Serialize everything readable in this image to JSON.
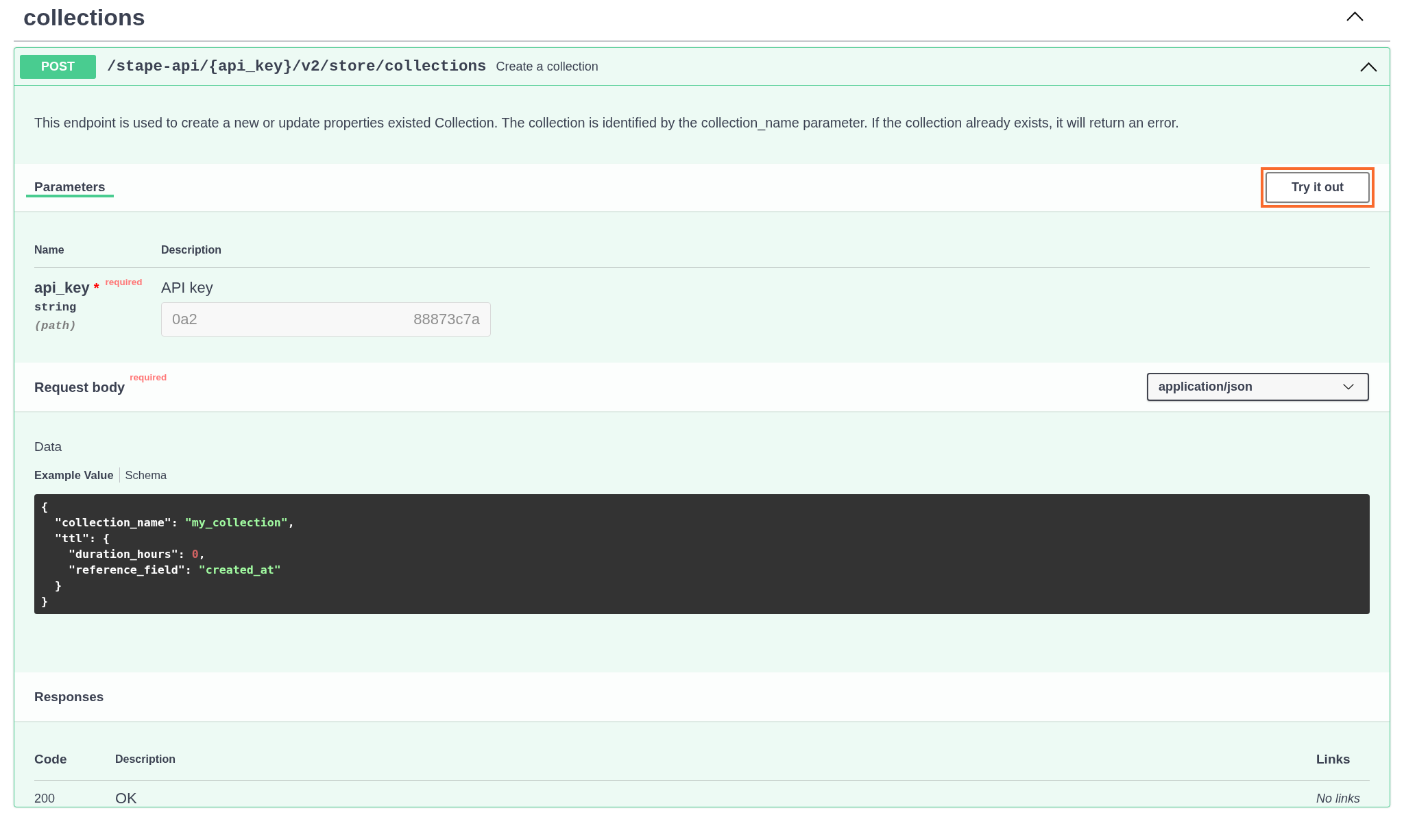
{
  "section": {
    "title": "collections",
    "expanded": true
  },
  "operation": {
    "method": "POST",
    "path": "/stape-api/{api_key}/v2/store/collections",
    "summary": "Create a collection",
    "expanded": true,
    "description": "This endpoint is used to create a new or update properties existed Collection. The collection is identified by the collection_name parameter. If the collection already exists, it will return an error.",
    "tabs": [
      {
        "label": "Parameters",
        "selected": true
      }
    ],
    "try_it_out": {
      "label": "Try it out",
      "highlighted": true
    },
    "parameters": {
      "columns": [
        "Name",
        "Description"
      ],
      "rows": [
        {
          "name": "api_key",
          "required": true,
          "required_mark": "*",
          "required_label": "required",
          "type": "string",
          "location": "(path)",
          "description": "API key",
          "field": {
            "value_start": "0a2",
            "value_end": "88873c7a",
            "disabled": true
          }
        }
      ]
    },
    "request_body": {
      "title": "Request body",
      "required": true,
      "required_label": "required",
      "content_type": "application/json",
      "media_label": "Data",
      "example_tabs": [
        {
          "label": "Example Value",
          "selected": true
        },
        {
          "label": "Schema",
          "selected": false
        }
      ],
      "example_lines": [
        [
          {
            "kind": "plain",
            "text": "{"
          }
        ],
        [
          {
            "kind": "plain",
            "text": "  \"collection_name\": "
          },
          {
            "kind": "string",
            "text": "\"my_collection\""
          },
          {
            "kind": "plain",
            "text": ","
          }
        ],
        [
          {
            "kind": "plain",
            "text": "  \"ttl\": {"
          }
        ],
        [
          {
            "kind": "plain",
            "text": "    \"duration_hours\": "
          },
          {
            "kind": "number",
            "text": "0"
          },
          {
            "kind": "plain",
            "text": ","
          }
        ],
        [
          {
            "kind": "plain",
            "text": "    \"reference_field\": "
          },
          {
            "kind": "string",
            "text": "\"created_at\""
          }
        ],
        [
          {
            "kind": "plain",
            "text": "  }"
          }
        ],
        [
          {
            "kind": "plain",
            "text": "}"
          }
        ]
      ]
    },
    "responses": {
      "title": "Responses",
      "columns": [
        "Code",
        "Description",
        "Links"
      ],
      "rows": [
        {
          "code": "200",
          "description": "OK",
          "links": "No links"
        }
      ]
    }
  }
}
